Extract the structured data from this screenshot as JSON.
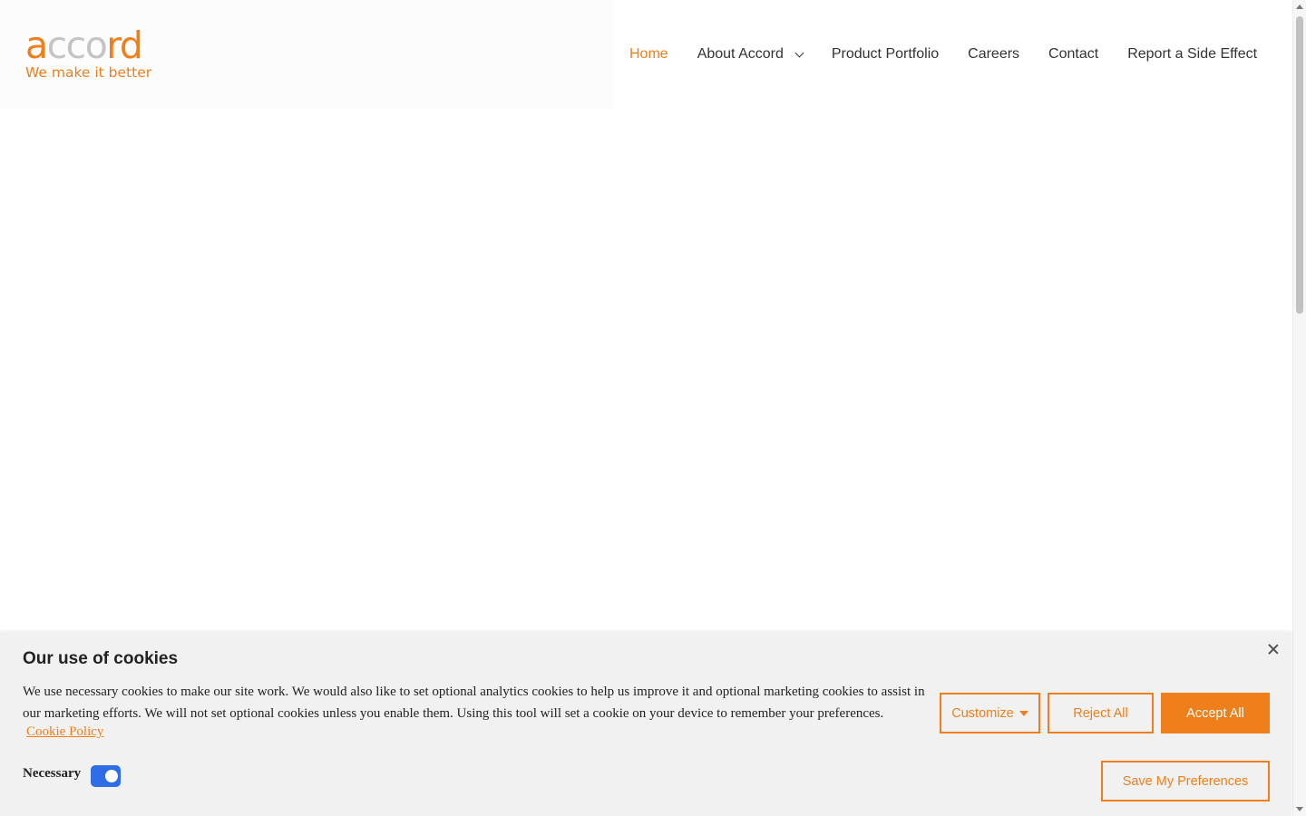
{
  "logo": {
    "word_start": "a",
    "word_middle": "cco",
    "word_end": "rd",
    "tagline": "We make it better"
  },
  "nav": {
    "items": [
      {
        "label": "Home"
      },
      {
        "label": "About Accord"
      },
      {
        "label": "Product Portfolio"
      },
      {
        "label": "Careers"
      },
      {
        "label": "Contact"
      },
      {
        "label": "Report a Side Effect"
      }
    ]
  },
  "cookie_banner": {
    "title": "Our use of cookies",
    "text": "We use necessary cookies to make our site work. We would also like to set optional analytics cookies to help us improve it and optional marketing cookies to assist in our marketing efforts. We will not set optional cookies unless you enable them. Using this tool will set a cookie on your device to remember your preferences.",
    "policy_link": "Cookie Policy",
    "necessary_label": "Necessary",
    "necessary_enabled": true,
    "buttons": {
      "customize": "Customize",
      "reject": "Reject All",
      "accept": "Accept All",
      "save": "Save My Preferences"
    }
  },
  "colors": {
    "brand_orange": "#ef7f1a",
    "toggle_blue": "#2f6ce5",
    "banner_bg": "#f1f1f1",
    "logo_grey": "#c4c4c4"
  },
  "icons": {
    "dropdown": "chevron-down-icon",
    "close": "close-icon",
    "customize": "caret-down-icon"
  }
}
